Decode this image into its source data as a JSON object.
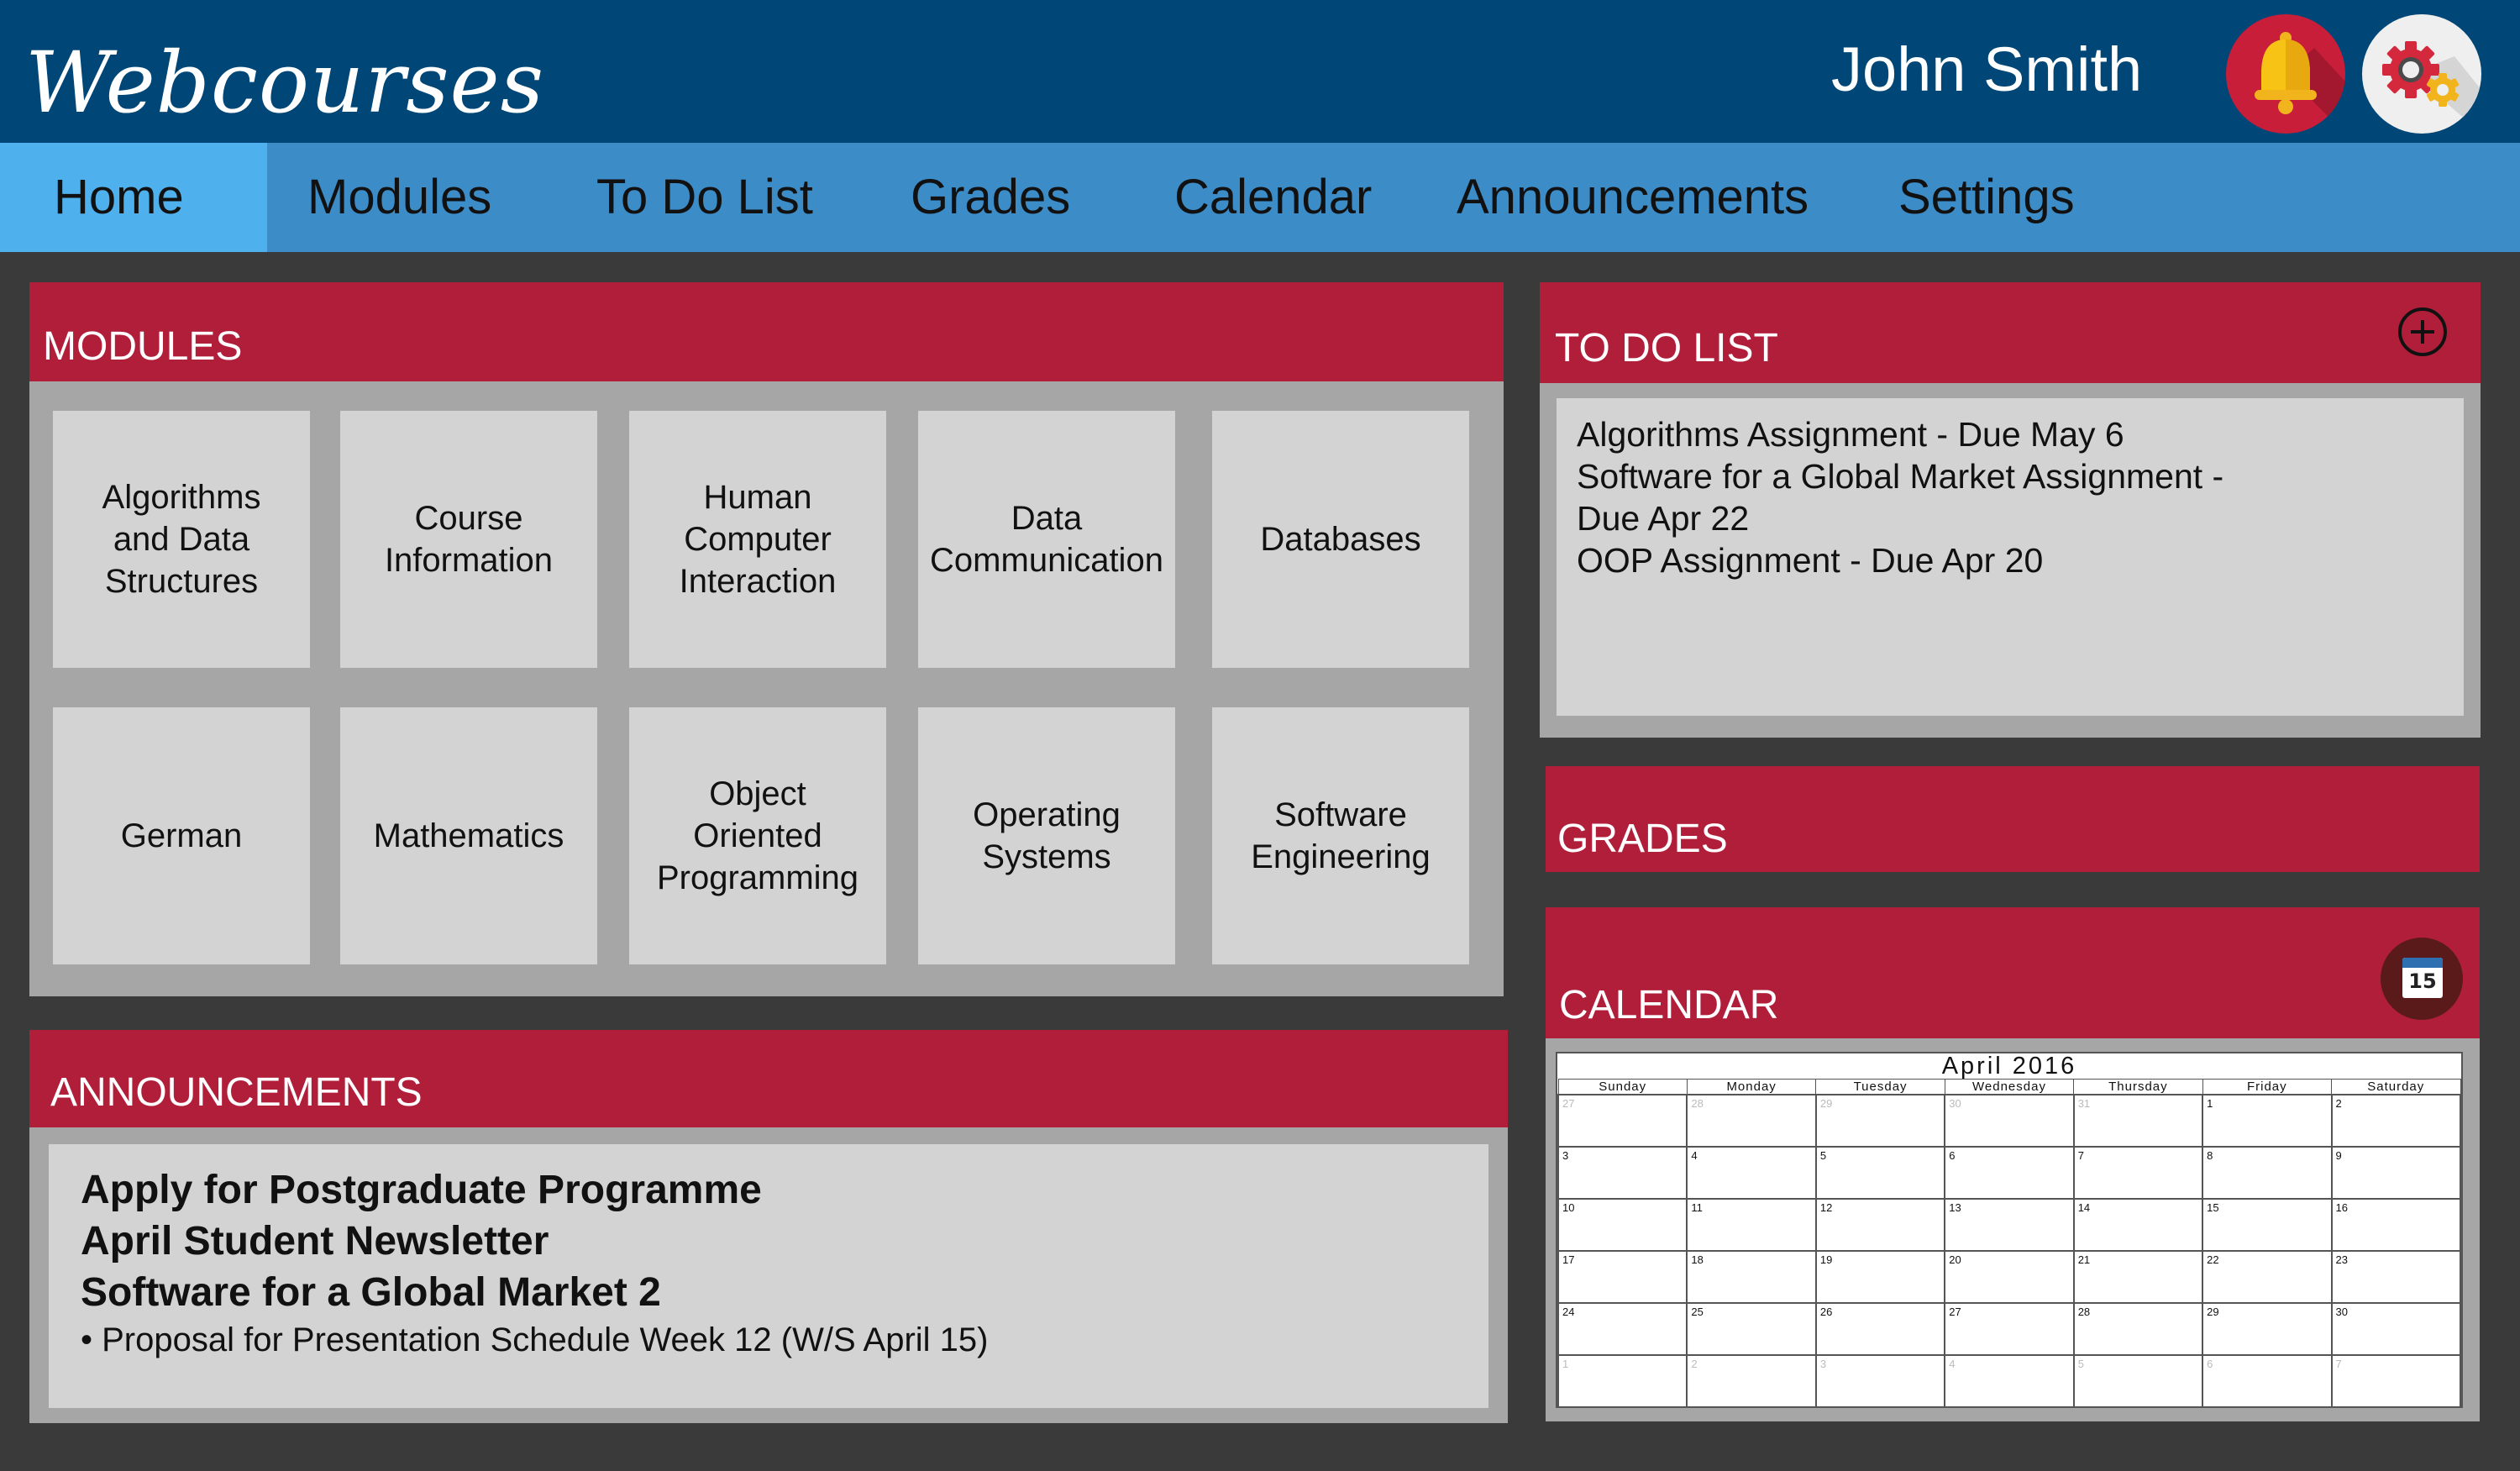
{
  "header": {
    "logo": "Webcourses",
    "user_name": "John Smith",
    "notification_icon": "bell-icon",
    "settings_icon": "gear-icon"
  },
  "nav": {
    "tabs": [
      {
        "label": "Home",
        "active": true
      },
      {
        "label": "Modules"
      },
      {
        "label": "To Do List"
      },
      {
        "label": "Grades"
      },
      {
        "label": "Calendar"
      },
      {
        "label": "Announcements"
      },
      {
        "label": "Settings"
      }
    ]
  },
  "modules": {
    "title": "MODULES",
    "items": [
      "Algorithms\nand Data\nStructures",
      "Course\nInformation",
      "Human\nComputer\nInteraction",
      "Data\nCommunication",
      "Databases",
      "German",
      "Mathematics",
      "Object\nOriented\nProgramming",
      "Operating\nSystems",
      "Software\nEngineering"
    ]
  },
  "todo": {
    "title": "TO DO LIST",
    "add_icon": "plus-circle-icon",
    "items": [
      "Algorithms Assignment - Due May 6",
      "Software for a Global Market Assignment -",
      "Due Apr 22",
      "OOP Assignment - Due Apr 20"
    ]
  },
  "grades": {
    "title": "GRADES"
  },
  "calendar": {
    "title": "CALENDAR",
    "icon": "calendar-icon",
    "icon_day": "15",
    "month_label": "April 2016",
    "weekdays": [
      "Sunday",
      "Monday",
      "Tuesday",
      "Wednesday",
      "Thursday",
      "Friday",
      "Saturday"
    ],
    "weeks": [
      [
        {
          "d": "27",
          "m": true
        },
        {
          "d": "28",
          "m": true
        },
        {
          "d": "29",
          "m": true
        },
        {
          "d": "30",
          "m": true
        },
        {
          "d": "31",
          "m": true
        },
        {
          "d": "1"
        },
        {
          "d": "2"
        }
      ],
      [
        {
          "d": "3"
        },
        {
          "d": "4"
        },
        {
          "d": "5"
        },
        {
          "d": "6"
        },
        {
          "d": "7"
        },
        {
          "d": "8"
        },
        {
          "d": "9"
        }
      ],
      [
        {
          "d": "10"
        },
        {
          "d": "11"
        },
        {
          "d": "12"
        },
        {
          "d": "13"
        },
        {
          "d": "14"
        },
        {
          "d": "15"
        },
        {
          "d": "16"
        }
      ],
      [
        {
          "d": "17"
        },
        {
          "d": "18"
        },
        {
          "d": "19"
        },
        {
          "d": "20"
        },
        {
          "d": "21"
        },
        {
          "d": "22"
        },
        {
          "d": "23"
        }
      ],
      [
        {
          "d": "24"
        },
        {
          "d": "25"
        },
        {
          "d": "26"
        },
        {
          "d": "27"
        },
        {
          "d": "28"
        },
        {
          "d": "29"
        },
        {
          "d": "30"
        }
      ],
      [
        {
          "d": "1",
          "m": true
        },
        {
          "d": "2",
          "m": true
        },
        {
          "d": "3",
          "m": true
        },
        {
          "d": "4",
          "m": true
        },
        {
          "d": "5",
          "m": true
        },
        {
          "d": "6",
          "m": true
        },
        {
          "d": "7",
          "m": true
        }
      ]
    ]
  },
  "announcements": {
    "title": "ANNOUNCEMENTS",
    "items": [
      "Apply for Postgraduate Programme",
      "April Student Newsletter",
      "Software for a Global Market 2"
    ],
    "bullet": "• Proposal for Presentation Schedule Week 12 (W/S April 15)"
  },
  "colors": {
    "header_bg": "#004676",
    "nav_bg": "#3c8cc8",
    "nav_active": "#4eb0ec",
    "panel_header": "#b01e3a",
    "page_bg": "#3a3a3a"
  }
}
